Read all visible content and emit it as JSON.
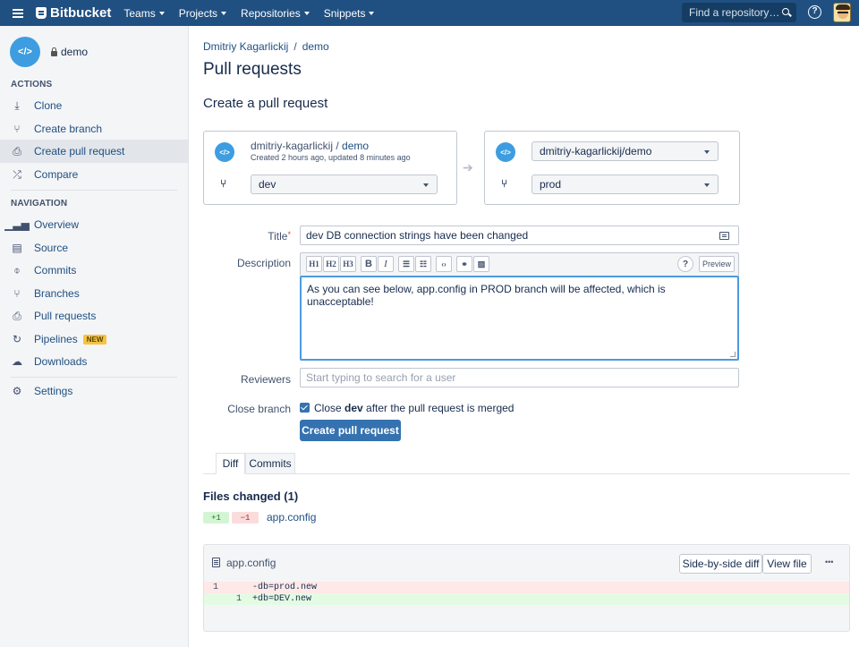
{
  "topnav": {
    "brand": "Bitbucket",
    "menu": [
      "Teams",
      "Projects",
      "Repositories",
      "Snippets"
    ],
    "search_placeholder": "Find a repository…"
  },
  "sidebar": {
    "repo_avatar_text": "</>",
    "repo_name": "demo",
    "actions_title": "ACTIONS",
    "actions": [
      {
        "label": "Clone",
        "icon": "clone-icon"
      },
      {
        "label": "Create branch",
        "icon": "create-branch-icon"
      },
      {
        "label": "Create pull request",
        "icon": "create-pr-icon",
        "active": true
      },
      {
        "label": "Compare",
        "icon": "compare-icon"
      }
    ],
    "navigation_title": "NAVIGATION",
    "navigation": [
      {
        "label": "Overview",
        "icon": "overview-icon"
      },
      {
        "label": "Source",
        "icon": "source-icon"
      },
      {
        "label": "Commits",
        "icon": "commits-icon"
      },
      {
        "label": "Branches",
        "icon": "branches-icon"
      },
      {
        "label": "Pull requests",
        "icon": "pull-requests-icon"
      },
      {
        "label": "Pipelines",
        "icon": "pipelines-icon",
        "badge": "NEW"
      },
      {
        "label": "Downloads",
        "icon": "downloads-icon"
      }
    ],
    "settings_label": "Settings"
  },
  "breadcrumb": {
    "owner": "Dmitriy Kagarlickij",
    "sep": "/",
    "repo": "demo"
  },
  "page_title": "Pull requests",
  "section_title": "Create a pull request",
  "source": {
    "repo_owner": "dmitriy-kagarlickij",
    "sep": " / ",
    "repo": "demo",
    "meta": "Created 2 hours ago, updated 8 minutes ago",
    "branch": "dev"
  },
  "destination": {
    "repo": "dmitriy-kagarlickij/demo",
    "branch": "prod"
  },
  "form": {
    "title_label": "Title",
    "title_value": "dev DB connection strings have been changed",
    "description_label": "Description",
    "toolbar": {
      "h1": "H1",
      "h2": "H2",
      "h3": "H3",
      "bold": "B",
      "italic": "I",
      "preview": "Preview"
    },
    "description_value": "As you can see below, app.config in PROD branch will be affected, which is unacceptable!",
    "reviewers_label": "Reviewers",
    "reviewers_placeholder": "Start typing to search for a user",
    "close_branch_label": "Close branch",
    "close_branch_pre": "Close ",
    "close_branch_bold": "dev",
    "close_branch_post": " after the pull request is merged",
    "submit_label": "Create pull request"
  },
  "tabs": [
    {
      "label": "Diff",
      "active": true
    },
    {
      "label": "Commits",
      "active": false
    }
  ],
  "files": {
    "title": "Files changed (1)",
    "added": "+1",
    "removed": "−1",
    "file_name": "app.config"
  },
  "diff": {
    "file_name": "app.config",
    "side_by_side_label": "Side-by-side diff",
    "view_file_label": "View file",
    "more_label": "•••",
    "lines": [
      {
        "old": "1",
        "new": "",
        "text": "-db=prod.new",
        "type": "del"
      },
      {
        "old": "",
        "new": "1",
        "text": "+db=DEV.new",
        "type": "add"
      }
    ]
  },
  "colors": {
    "nav": "#205081",
    "primary": "#3572b0",
    "link": "#205081",
    "add": "#e3fbe3",
    "del": "#ffe8e8"
  }
}
